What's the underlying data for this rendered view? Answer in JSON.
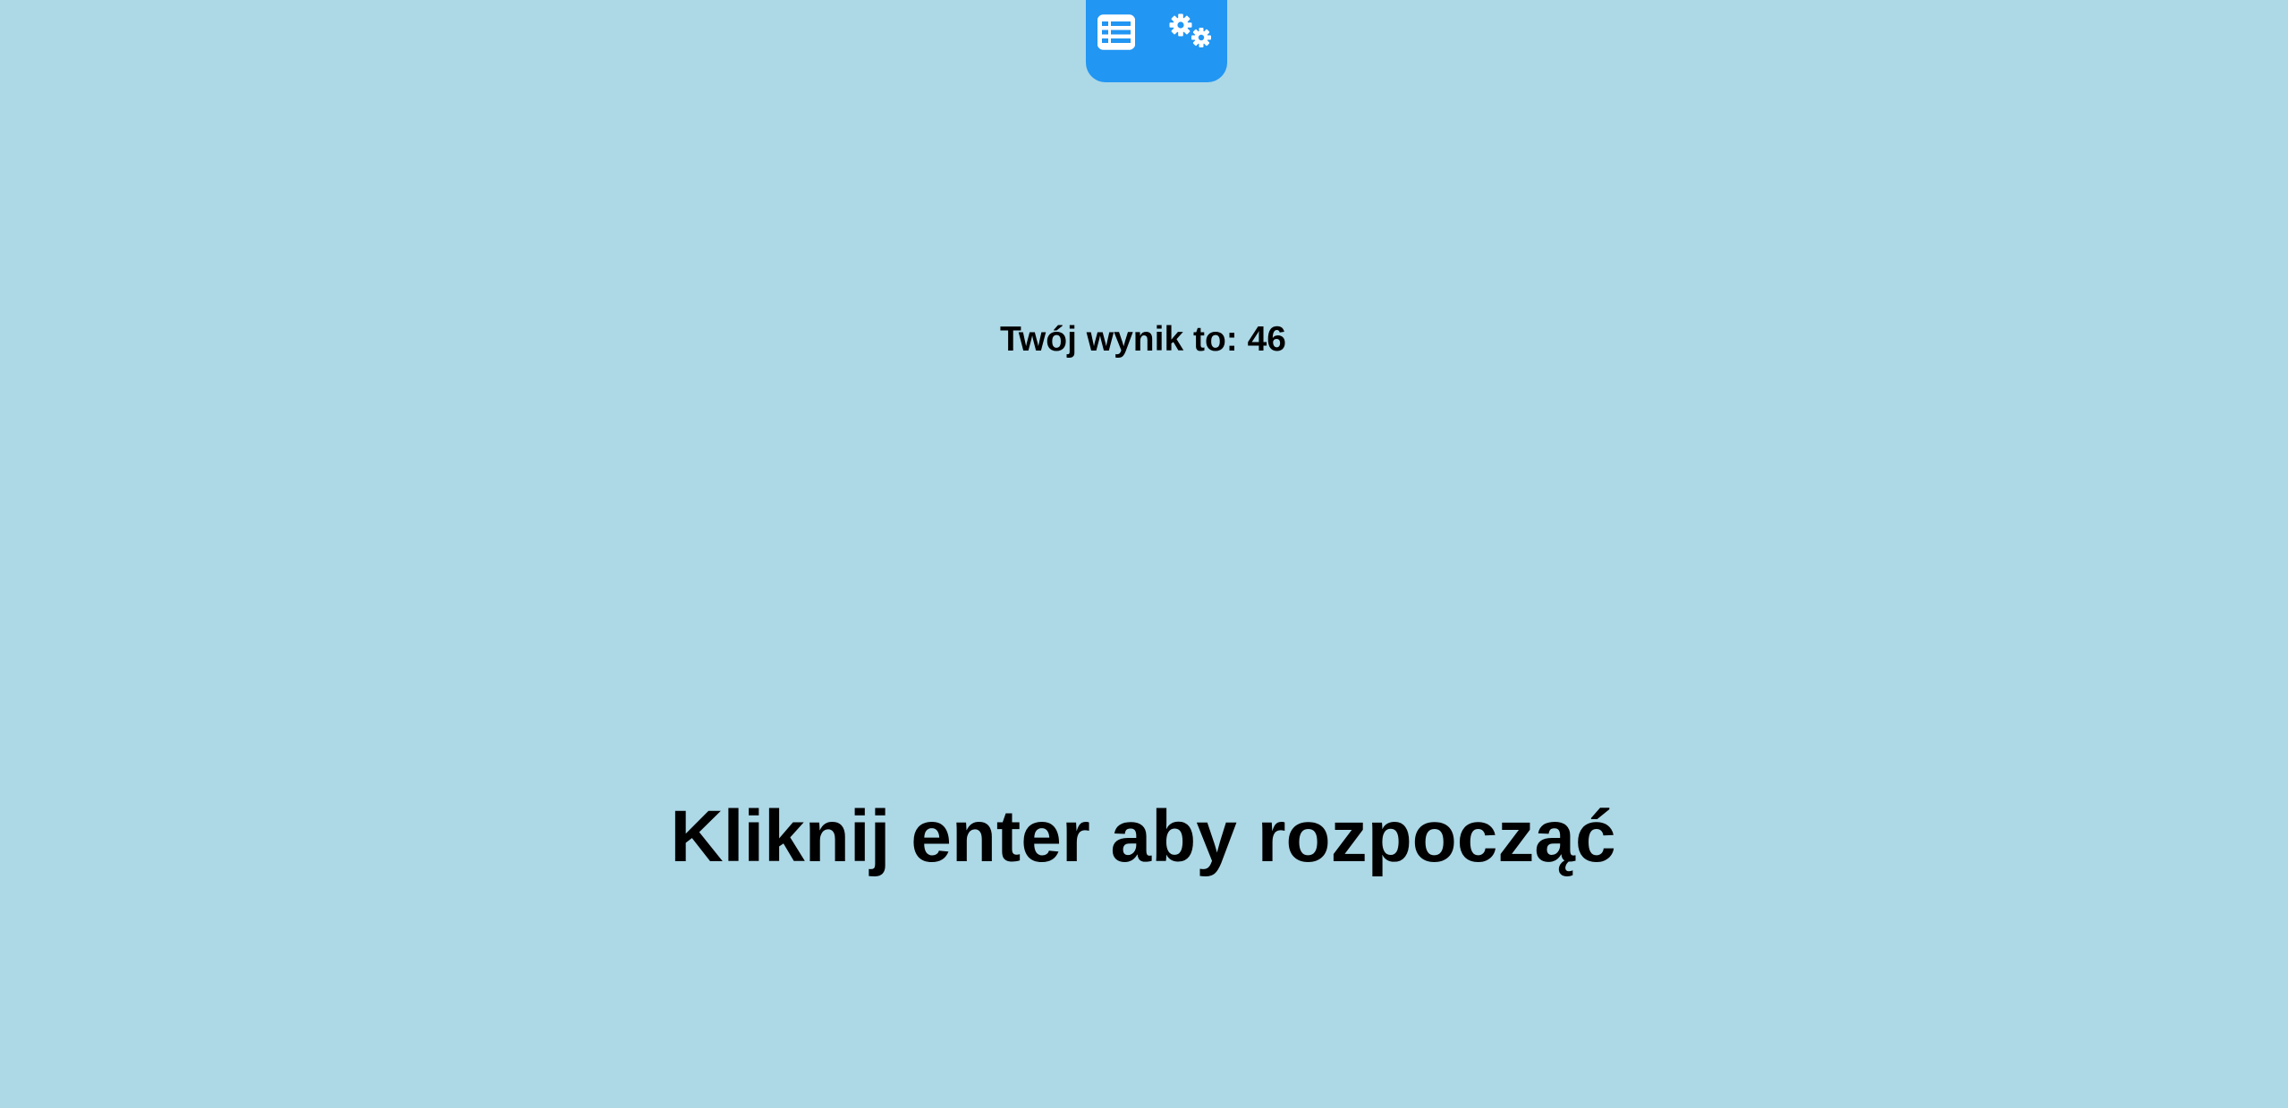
{
  "toolbar": {
    "buttons": [
      {
        "icon": "list-icon"
      },
      {
        "icon": "settings-gears-icon"
      }
    ],
    "accent_color": "#2196f3"
  },
  "score": {
    "label": "Twój wynik to:",
    "value": "46"
  },
  "prompt": {
    "text": "Kliknij enter aby rozpocząć"
  },
  "background_color": "#add8e6"
}
